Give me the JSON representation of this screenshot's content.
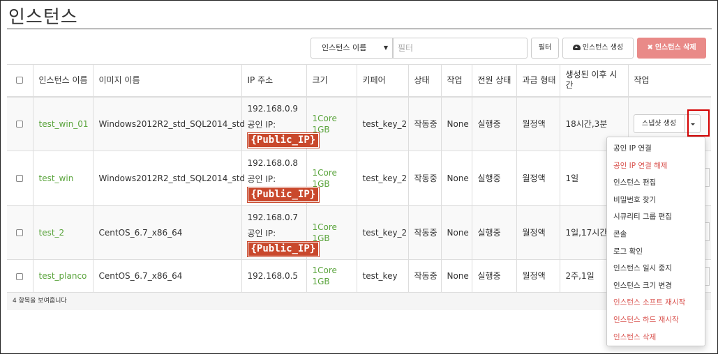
{
  "page": {
    "title": "인스턴스"
  },
  "toolbar": {
    "select_value": "인스턴스 이름",
    "filter_placeholder": "필터",
    "filter_button": "필터",
    "create_button": "인스턴스 생성",
    "delete_button": "인스턴스 삭제"
  },
  "table": {
    "headers": [
      "인스턴스 이름",
      "이미지 이름",
      "IP 주소",
      "크기",
      "키페어",
      "상태",
      "작업",
      "전원 상태",
      "과금 형태",
      "생성된 이후 시간",
      "작업"
    ],
    "ip_public_label": "공인 IP:",
    "public_ip_badge": "{Public_IP}",
    "rows": [
      {
        "name": "test_win_01",
        "image": "Windows2012R2_std_SQL2014_std",
        "ip": "192.168.0.9",
        "size": "1Core",
        "size_ram": "1GB",
        "keypair": "test_key_2",
        "status": "작동중",
        "task": "None",
        "power": "실행중",
        "billing": "월정액",
        "age": "18시간,3분",
        "action": "스냅샷 생성"
      },
      {
        "name": "test_win",
        "image": "Windows2012R2_std_SQL2014_std",
        "ip": "192.168.0.8",
        "size": "1Core",
        "size_ram": "1GB",
        "keypair": "test_key_2",
        "status": "작동중",
        "task": "None",
        "power": "실행중",
        "billing": "월정액",
        "age": "1일"
      },
      {
        "name": "test_2",
        "image": "CentOS_6.7_x86_64",
        "ip": "192.168.0.7",
        "size": "1Core",
        "size_ram": "1GB",
        "keypair": "test_key_2",
        "status": "작동중",
        "task": "None",
        "power": "실행중",
        "billing": "월정액",
        "age": "1일,17시간"
      },
      {
        "name": "test_planco",
        "image": "CentOS_6.7_x86_64",
        "ip": "192.168.0.5",
        "size": "1Core",
        "size_ram": "1GB",
        "keypair": "test_key",
        "status": "작동중",
        "task": "None",
        "power": "실행중",
        "billing": "월정액",
        "age": "2주,1일"
      }
    ],
    "footer": "4 항목을 보여줍니다"
  },
  "dropdown": {
    "items": [
      {
        "label": "공인 IP 연결",
        "danger": false
      },
      {
        "label": "공인 IP 연결 해제",
        "danger": true
      },
      {
        "label": "인스턴스 편집",
        "danger": false
      },
      {
        "label": "비밀번호 찾기",
        "danger": false
      },
      {
        "label": "시큐리티 그룹 편집",
        "danger": false
      },
      {
        "label": "콘솔",
        "danger": false
      },
      {
        "label": "로그 확인",
        "danger": false
      },
      {
        "label": "인스턴스 일시 중지",
        "danger": false
      },
      {
        "label": "인스턴스 크기 변경",
        "danger": false
      },
      {
        "label": "인스턴스 소프트 재시작",
        "danger": true
      },
      {
        "label": "인스턴스 하드 재시작",
        "danger": true
      },
      {
        "label": "인스턴스 삭제",
        "danger": true
      }
    ]
  },
  "colors": {
    "link_green": "#5aa43c",
    "danger_red": "#d9534f",
    "delete_button_bg": "#e98a88",
    "public_ip_badge_bg": "#c9482c",
    "highlight_box": "#d40000"
  }
}
